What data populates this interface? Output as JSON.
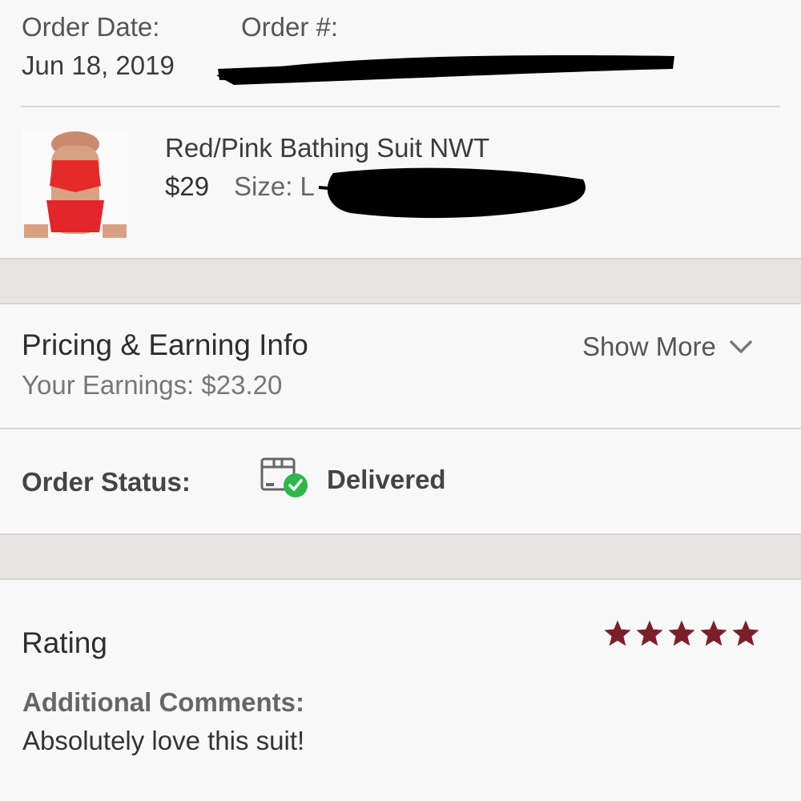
{
  "order": {
    "date_label": "Order Date:",
    "date_value": "Jun 18, 2019",
    "number_label": "Order #:"
  },
  "item": {
    "title": "Red/Pink Bathing Suit NWT",
    "price": "$29",
    "size": "Size: L"
  },
  "pricing": {
    "title": "Pricing & Earning Info",
    "earnings": "Your Earnings: $23.20",
    "show_more": "Show More"
  },
  "status": {
    "label": "Order Status:",
    "value": "Delivered",
    "icon": "package-delivered-icon",
    "check_color": "#2eb84b"
  },
  "rating": {
    "title": "Rating",
    "stars": 5,
    "max_stars": 5,
    "star_color": "#7a1f2b",
    "comments_label": "Additional Comments:",
    "comment": "Absolutely love this suit!"
  }
}
